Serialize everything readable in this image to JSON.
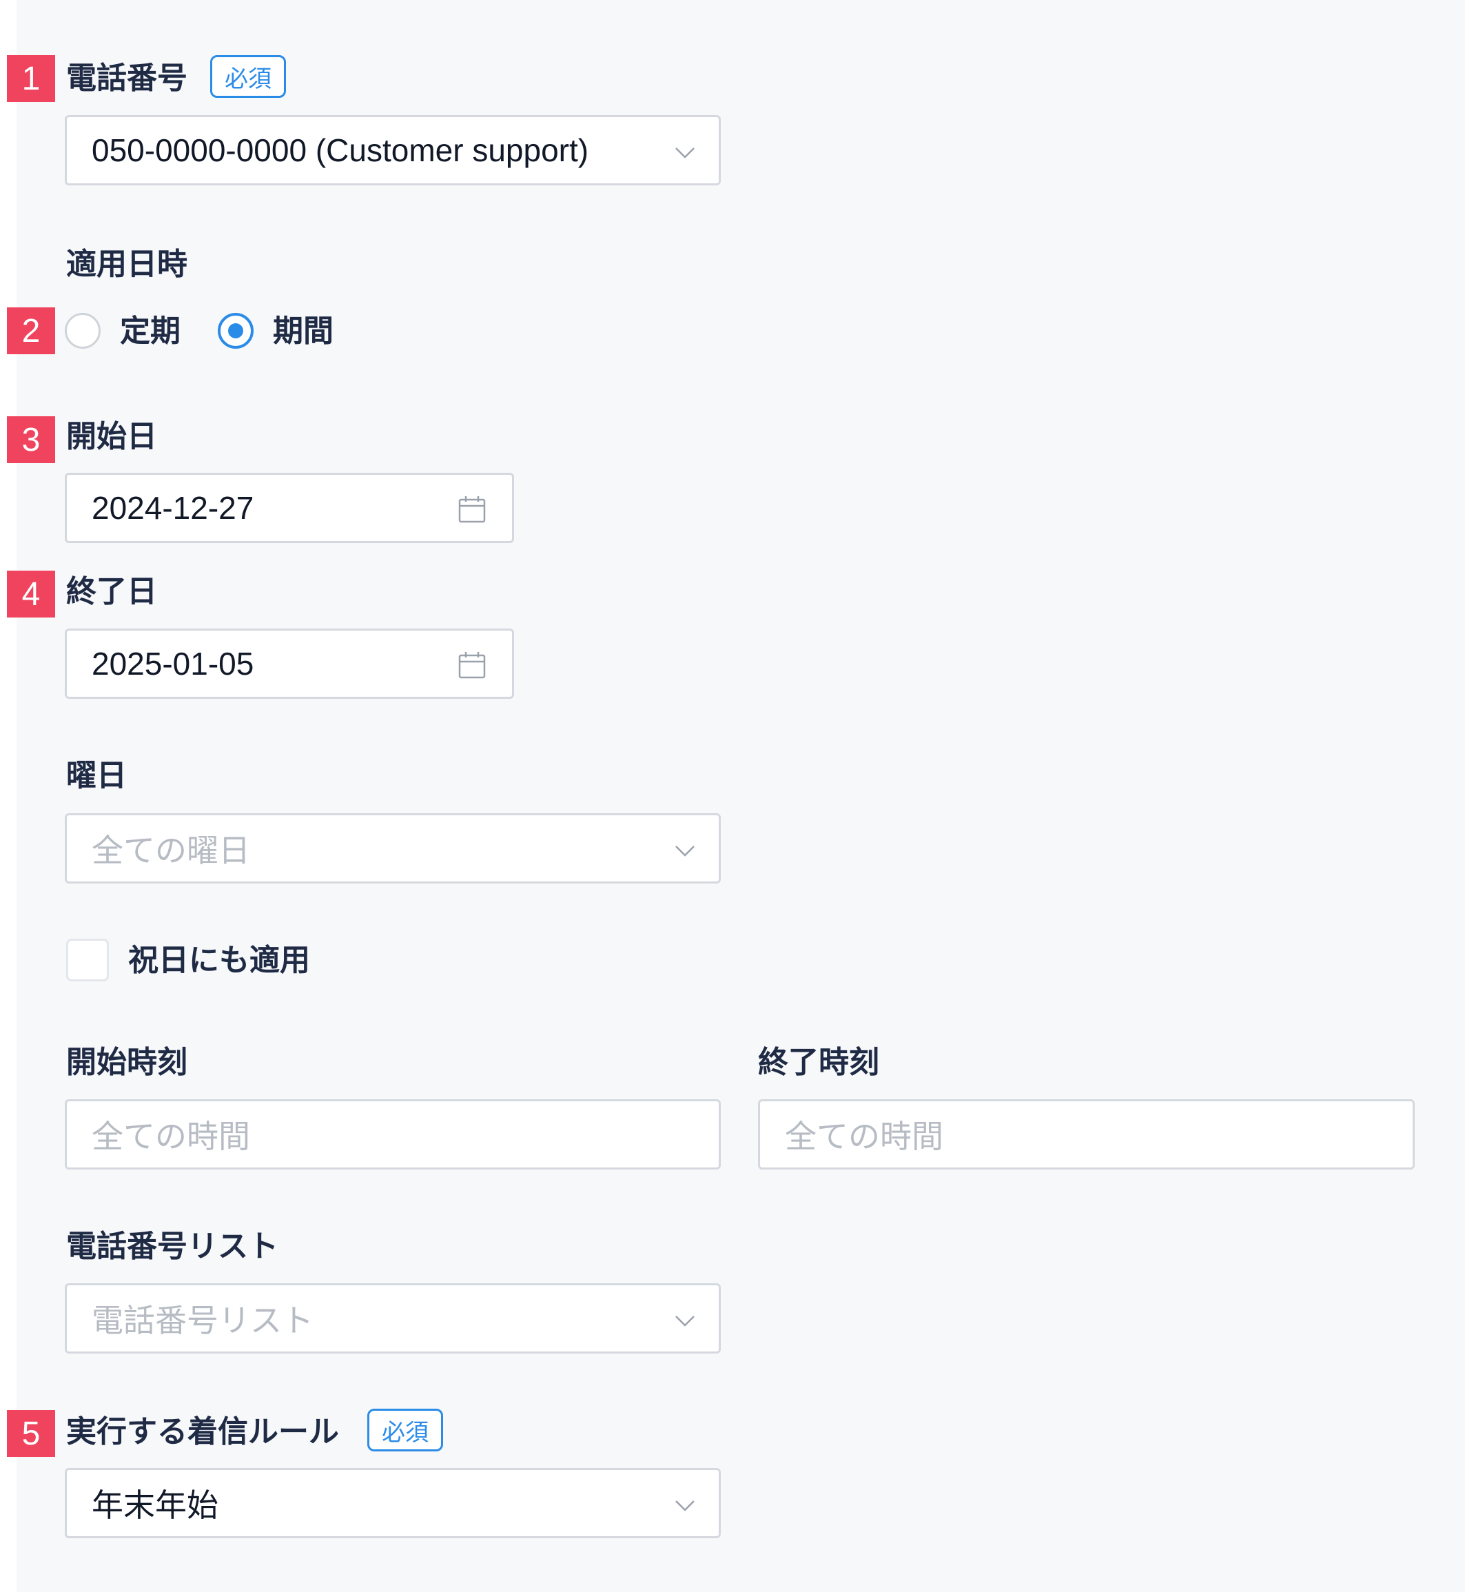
{
  "markers": [
    "1",
    "2",
    "3",
    "4",
    "5"
  ],
  "phone": {
    "label": "電話番号",
    "required": "必須",
    "value": "050-0000-0000 (Customer support)"
  },
  "apply": {
    "label": "適用日時",
    "options": [
      {
        "label": "定期",
        "selected": false
      },
      {
        "label": "期間",
        "selected": true
      }
    ]
  },
  "start_date": {
    "label": "開始日",
    "value": "2024-12-27"
  },
  "end_date": {
    "label": "終了日",
    "value": "2025-01-05"
  },
  "weekday": {
    "label": "曜日",
    "placeholder": "全ての曜日"
  },
  "holiday": {
    "label": "祝日にも適用",
    "checked": false
  },
  "start_time": {
    "label": "開始時刻",
    "placeholder": "全ての時間"
  },
  "end_time": {
    "label": "終了時刻",
    "placeholder": "全ての時間"
  },
  "phone_list": {
    "label": "電話番号リスト",
    "placeholder": "電話番号リスト"
  },
  "rule": {
    "label": "実行する着信ルール",
    "required": "必須",
    "value": "年末年始"
  },
  "colors": {
    "marker": "#f0445e",
    "accent": "#2b8ce8",
    "label": "#1f2a44",
    "placeholder": "#b7bcc4",
    "border": "#d5d9df",
    "panel": "#f7f8fa"
  }
}
